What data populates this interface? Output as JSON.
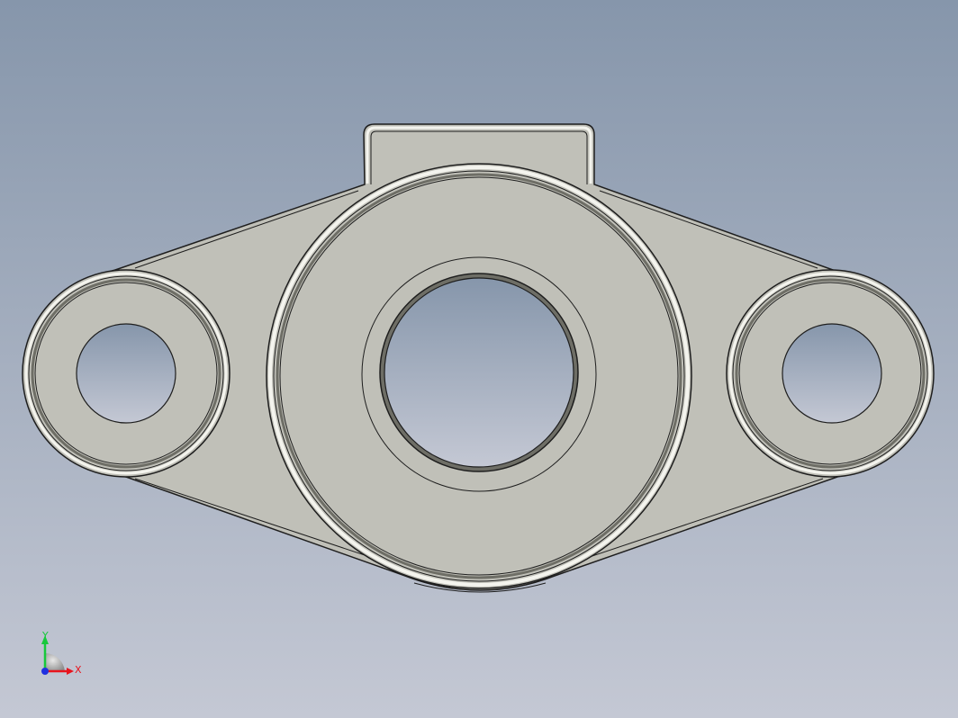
{
  "viewport": {
    "background_top": "#8696ab",
    "background_bottom": "#c4c8d4"
  },
  "part": {
    "face_color": "#c0c0b8",
    "edge_color": "#1e1e1e",
    "highlight_color": "#f4f4ee",
    "shadow_color": "#6e6e66"
  },
  "triad": {
    "x_label": "X",
    "y_label": "Y",
    "x_color": "#e8141e",
    "y_color": "#18c83c",
    "origin_color": "#2030e0"
  }
}
